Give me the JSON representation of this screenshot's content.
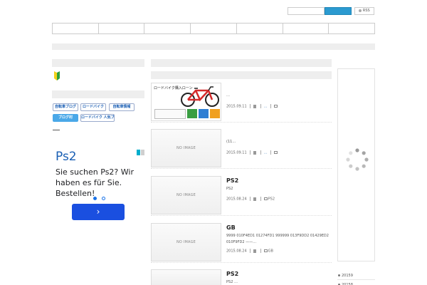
{
  "header": {
    "search_placeholder": "",
    "search_button_label": "",
    "rss_label": "RSS"
  },
  "nav": {
    "items": [
      "",
      "",
      "",
      "",
      "",
      "",
      ""
    ]
  },
  "sidebar": {
    "banners": [
      {
        "label": "自転車ブログ",
        "style": "outline"
      },
      {
        "label": "ロードバイク",
        "style": "outline"
      },
      {
        "label": "自転車情報",
        "style": "outline"
      },
      {
        "label": "ブログ村",
        "style": "lightblue"
      },
      {
        "label": "ロードバイク 人気ブログランキング",
        "style": "outline"
      }
    ],
    "beginner_mark_colors": [
      "#2e9e3e",
      "#f2d21b"
    ]
  },
  "ad": {
    "title": "Ps2",
    "body": "Sie suchen Ps2? Wir haben es für Sie. Bestellen!",
    "button_label": "›",
    "button_color": "#1a4fe0"
  },
  "posts": [
    {
      "thumb_type": "image",
      "thumb_text": "ロードバイク購入ローン",
      "title": "",
      "excerpt": "…",
      "date": "2015.09.11",
      "comments": "…",
      "tags": ""
    },
    {
      "thumb_type": "placeholder",
      "thumb_text": "NO IMAGE",
      "title": "",
      "excerpt": "(11…",
      "date": "2015.09.11",
      "comments": "…",
      "tags": ""
    },
    {
      "thumb_type": "placeholder",
      "thumb_text": "NO IMAGE",
      "title": "PS2",
      "excerpt": "PS2",
      "date": "2015.08.24",
      "comments": "",
      "tags": "PS2"
    },
    {
      "thumb_type": "placeholder",
      "thumb_text": "NO IMAGE",
      "title": "GB",
      "excerpt": "9999 010F4ED1 01274FD1 999999 013F9DD2 01429ED2 010F9FD2 ——…",
      "date": "2015.08.24",
      "comments": "",
      "tags": "GB"
    },
    {
      "thumb_type": "placeholder",
      "thumb_text": "NO IMAGE",
      "title": "PS2",
      "excerpt": "PS2 …",
      "date": "",
      "comments": "",
      "tags": ""
    }
  ],
  "archives": [
    "20159",
    "20158"
  ],
  "colors": {
    "accent": "#2b9ad0",
    "light_bar": "#eeeeee"
  }
}
